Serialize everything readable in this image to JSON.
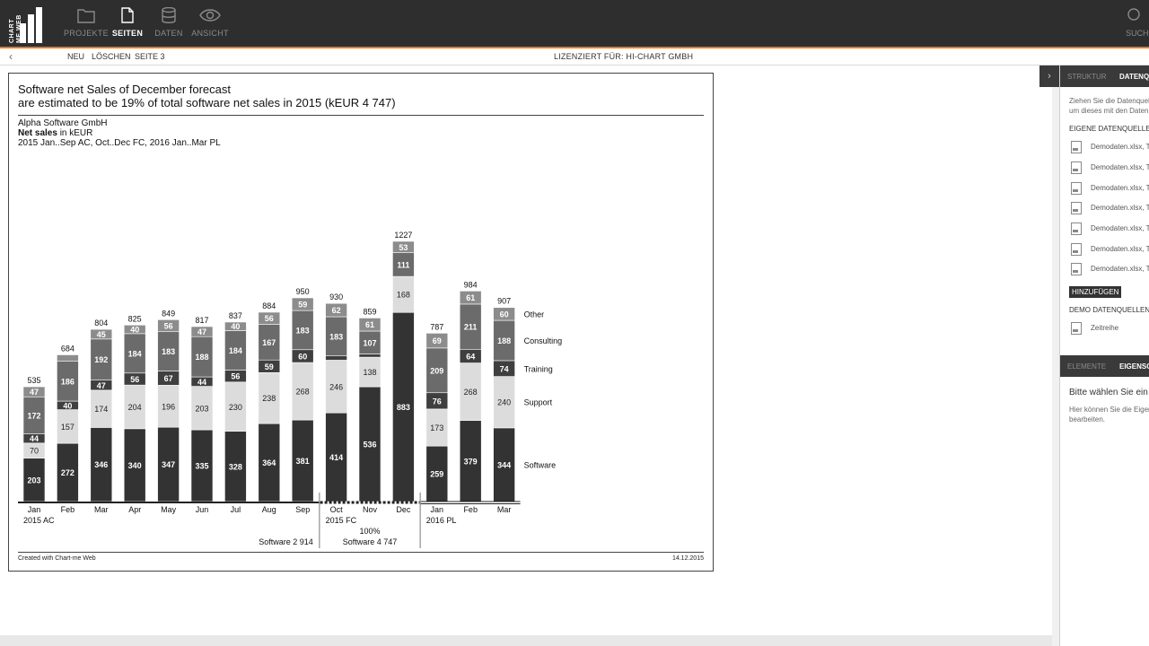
{
  "toolbar": {
    "logo_text": "CHART ME WEB",
    "items": [
      {
        "label": "PROJEKTE",
        "icon": "folder-icon"
      },
      {
        "label": "SEITEN",
        "icon": "page-icon"
      },
      {
        "label": "DATEN",
        "icon": "database-icon"
      },
      {
        "label": "ANSICHT",
        "icon": "eye-icon"
      }
    ],
    "search_label": "SUCHE"
  },
  "subbar": {
    "back_icon": "chevron-left-icon",
    "new_label": "NEU",
    "delete_label": "LÖSCHEN",
    "page_label": "SEITE 3",
    "license": "LIZENZIERT FÜR: HI-CHART GMBH"
  },
  "report": {
    "title_line1": "Software net Sales of December forecast",
    "title_line2": "are estimated to be 19% of total software net sales in 2015 (kEUR 4 747)",
    "company": "Alpha Software GmbH",
    "measure_bold": "Net sales",
    "measure_rest": " in kEUR",
    "period": "2015 Jan..Sep AC, Oct..Dec FC, 2016 Jan..Mar PL",
    "footer_left": "Created with Chart-me Web",
    "footer_right": "14.12.2015"
  },
  "chart_data": {
    "type": "bar",
    "stacked": true,
    "categories": [
      "Jan",
      "Feb",
      "Mar",
      "Apr",
      "May",
      "Jun",
      "Jul",
      "Aug",
      "Sep",
      "Oct",
      "Nov",
      "Dec",
      "Jan",
      "Feb",
      "Mar"
    ],
    "scenarios": [
      "AC",
      "AC",
      "AC",
      "AC",
      "AC",
      "AC",
      "AC",
      "AC",
      "AC",
      "FC",
      "FC",
      "FC",
      "PL",
      "PL",
      "PL"
    ],
    "group_labels": [
      {
        "text": "2015 AC",
        "start": 0
      },
      {
        "text": "2015 FC",
        "start": 9
      },
      {
        "text": "2016 PL",
        "start": 12
      }
    ],
    "series": [
      {
        "name": "Software",
        "color": "#333333",
        "values": [
          203,
          272,
          346,
          340,
          347,
          335,
          328,
          364,
          381,
          414,
          536,
          883,
          259,
          379,
          344
        ]
      },
      {
        "name": "Support",
        "color": "#dcdcdc",
        "values": [
          70,
          157,
          174,
          204,
          196,
          203,
          230,
          238,
          268,
          246,
          138,
          168,
          173,
          268,
          240
        ]
      },
      {
        "name": "Training",
        "color": "#3f3f3f",
        "values": [
          44,
          40,
          47,
          56,
          67,
          44,
          56,
          59,
          60,
          20,
          15,
          0,
          76,
          64,
          74
        ]
      },
      {
        "name": "Consulting",
        "color": "#6b6b6b",
        "values": [
          172,
          186,
          192,
          184,
          183,
          188,
          184,
          167,
          183,
          183,
          107,
          111,
          209,
          211,
          188
        ]
      },
      {
        "name": "Other",
        "color": "#8c8c8c",
        "values": [
          47,
          30,
          45,
          40,
          56,
          47,
          40,
          56,
          59,
          62,
          61,
          53,
          69,
          61,
          60
        ]
      }
    ],
    "totals": [
      535,
      684,
      804,
      825,
      849,
      817,
      837,
      884,
      950,
      930,
      859,
      1227,
      787,
      984,
      907
    ],
    "annotations": [
      {
        "text": "Software 2 914"
      },
      {
        "text": "100%"
      },
      {
        "text": "Software 4 747"
      }
    ]
  },
  "panel": {
    "tab_structure": "STRUKTUR",
    "tab_data": "DATENQUELLEN",
    "hint_line1": "Ziehen Sie die Datenquelle",
    "hint_line2": "um dieses mit den Daten",
    "own_sources_heading": "EIGENE DATENQUELLEN",
    "files": [
      "Demodaten.xlsx, Tab",
      "Demodaten.xlsx, Tab",
      "Demodaten.xlsx, Tab",
      "Demodaten.xlsx, Tab",
      "Demodaten.xlsx, Tab",
      "Demodaten.xlsx, Tab",
      "Demodaten.xlsx, Tab"
    ],
    "add_button": "HINZUFÜGEN",
    "demo_sources_heading": "DEMO DATENQUELLEN",
    "demo_file": "Zeitreihe",
    "tab_elements": "ELEMENTE",
    "tab_properties": "EIGENSCHAFTEN",
    "prompt_title": "Bitte wählen Sie ein",
    "prompt_line1": "Hier können Sie die Eigens",
    "prompt_line2": "bearbeiten."
  }
}
